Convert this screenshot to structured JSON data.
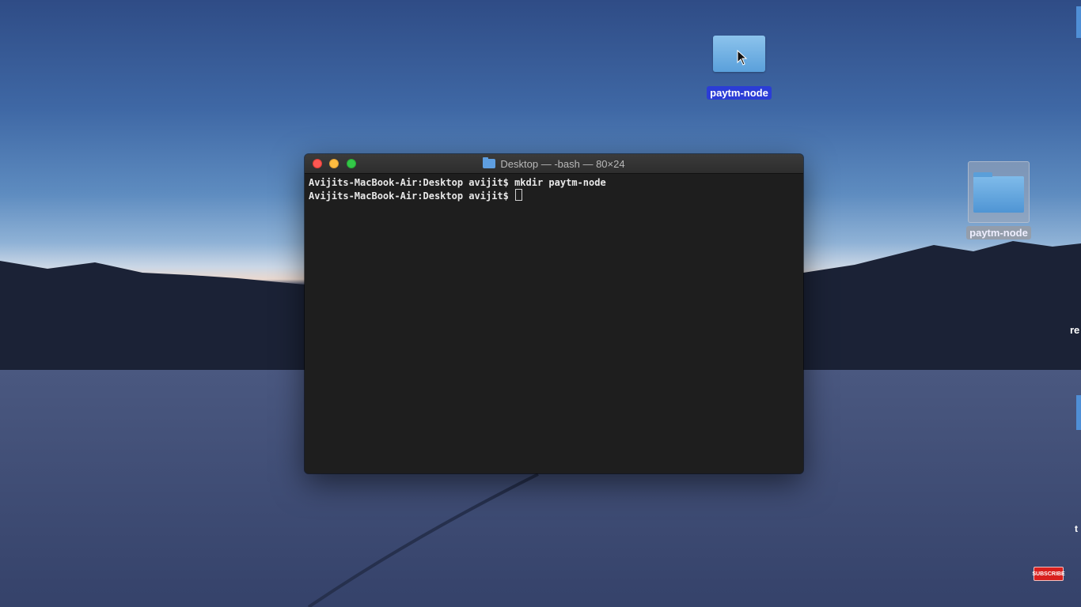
{
  "terminal": {
    "title": "Desktop — -bash — 80×24",
    "lines": [
      "Avijits-MacBook-Air:Desktop avijit$ mkdir paytm-node",
      "Avijits-MacBook-Air:Desktop avijit$ "
    ]
  },
  "desktop_icons": [
    {
      "label": "paytm-node",
      "state": "renaming-selected"
    },
    {
      "label": "paytm-node",
      "state": "selected"
    }
  ],
  "edge_texts": {
    "re": "re",
    "t": "t"
  },
  "subscribe_label": "SUBSCRIBE",
  "colors": {
    "close": "#fc5753",
    "minimize": "#fdbc40",
    "maximize": "#33c748",
    "terminal_bg": "#1e1e1e",
    "selection": "#2b3dd6"
  }
}
